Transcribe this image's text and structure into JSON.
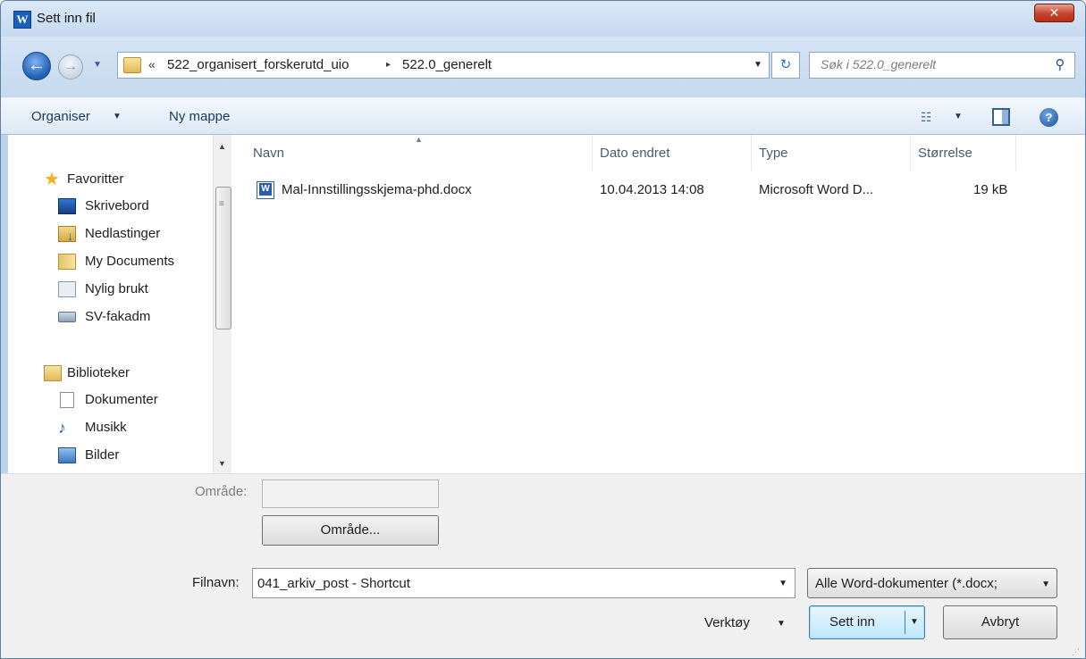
{
  "window": {
    "title": "Sett inn fil",
    "app_icon_letter": "W",
    "close_symbol": "✕"
  },
  "address": {
    "overflow": "«",
    "crumbs": [
      "522_organisert_forskerutd_uio",
      "522.0_generelt"
    ],
    "separator": "▸",
    "dropdown": "▼",
    "refresh_symbol": "↻",
    "search_placeholder": "Søk i 522.0_generelt",
    "search_symbol": "⚲"
  },
  "nav_buttons": {
    "back": "←",
    "forward": "→",
    "history": "▼"
  },
  "toolbar": {
    "organise_label": "Organiser",
    "organise_arrow": "▼",
    "new_folder_label": "Ny mappe",
    "views_symbol": "☷",
    "views_arrow": "▼",
    "help_symbol": "?"
  },
  "nav": {
    "favorites": {
      "label": "Favoritter",
      "items": [
        {
          "label": "Skrivebord",
          "icon": "desktop-icon"
        },
        {
          "label": "Nedlastinger",
          "icon": "downloads-icon"
        },
        {
          "label": "My Documents",
          "icon": "my-documents-icon"
        },
        {
          "label": "Nylig brukt",
          "icon": "recent-places-icon"
        },
        {
          "label": "SV-fakadm",
          "icon": "network-drive-icon"
        }
      ]
    },
    "libraries": {
      "label": "Biblioteker",
      "items": [
        {
          "label": "Dokumenter",
          "icon": "documents-icon"
        },
        {
          "label": "Musikk",
          "icon": "music-icon"
        },
        {
          "label": "Bilder",
          "icon": "pictures-icon"
        }
      ]
    },
    "star_symbol": "★",
    "music_symbol": "♪",
    "scroll_up": "▲",
    "scroll_down": "▼",
    "scroll_grip": "≡"
  },
  "files": {
    "sort_indicator": "▲",
    "columns": [
      "Navn",
      "Dato endret",
      "Type",
      "Størrelse"
    ],
    "rows": [
      {
        "name": "Mal-Innstillingsskjema-phd.docx",
        "date": "10.04.2013 14:08",
        "type": "Microsoft Word D...",
        "size": "19 kB"
      }
    ]
  },
  "footer": {
    "area_label": "Område:",
    "area_value": "",
    "area_button": "Område...",
    "filename_label": "Filnavn:",
    "filename_value": "041_arkiv_post - Shortcut",
    "filename_dropdown": "▼",
    "filter_value": "Alle Word-dokumenter (*.docx;",
    "filter_dropdown": "▼",
    "tools_label": "Verktøy",
    "tools_arrow": "▼",
    "insert_label": "Sett inn",
    "insert_dropdown": "▼",
    "cancel_label": "Avbryt",
    "resize_grip": "⋰"
  }
}
